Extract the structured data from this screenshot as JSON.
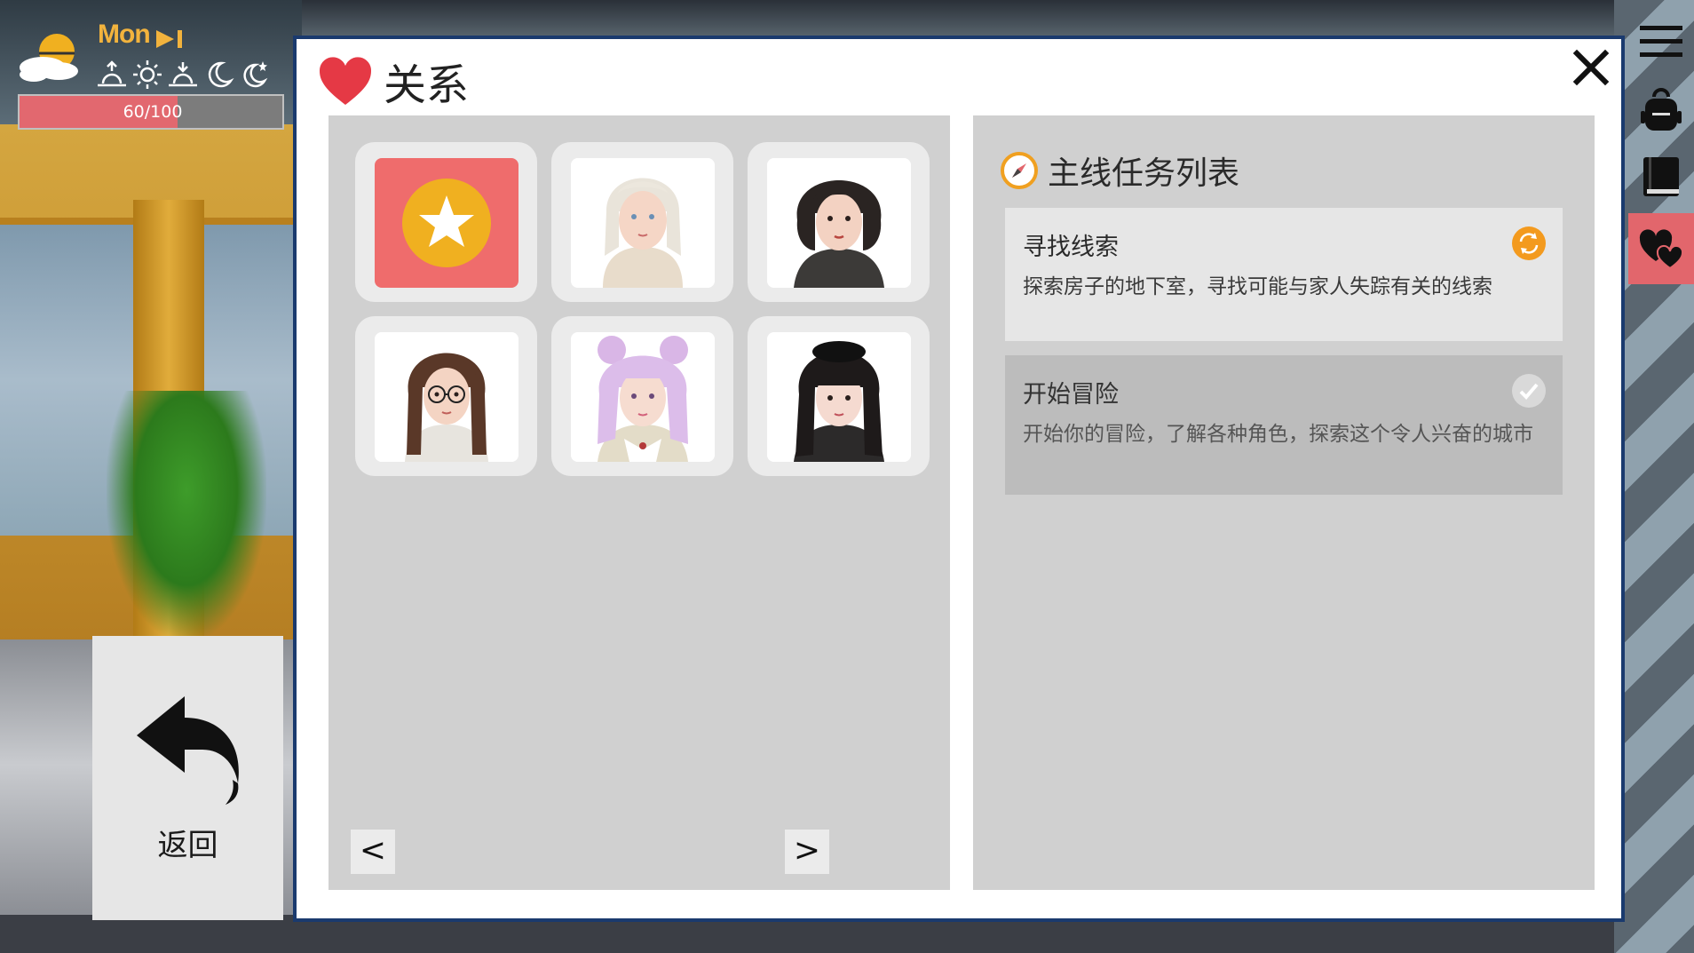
{
  "hud": {
    "day": "Mon",
    "energy_text": "60/100",
    "energy_fraction": 0.6,
    "weather_icon": "sun-behind-cloud-icon",
    "time_icons": [
      "sunrise-icon",
      "sun-icon",
      "sunset-icon",
      "moon-icon",
      "moon-star-icon"
    ]
  },
  "back_button": {
    "label": "返回",
    "icon": "undo-arrow-icon"
  },
  "sidebar": {
    "items": [
      {
        "name": "menu",
        "icon": "hamburger-menu-icon"
      },
      {
        "name": "backpack",
        "icon": "backpack-icon"
      },
      {
        "name": "journal",
        "icon": "book-icon"
      },
      {
        "name": "relationship",
        "icon": "hearts-icon",
        "active": true
      }
    ]
  },
  "dialog": {
    "title": "关系",
    "title_icon": "heart-icon",
    "close_icon": "close-icon"
  },
  "characters": [
    {
      "slot": "favorites",
      "icon": "star-icon"
    },
    {
      "slot": "character",
      "hair": "platinum blonde"
    },
    {
      "slot": "character",
      "hair": "black bob"
    },
    {
      "slot": "character",
      "hair": "brown braids, glasses"
    },
    {
      "slot": "character",
      "hair": "pink buns"
    },
    {
      "slot": "character",
      "hair": "long black"
    }
  ],
  "pagination": {
    "prev": "<",
    "next": ">"
  },
  "quests": {
    "title": "主线任务列表",
    "title_icon": "compass-icon",
    "items": [
      {
        "name": "寻找线索",
        "desc": "探索房子的地下室，寻找可能与家人失踪有关的线索",
        "status": "in-progress"
      },
      {
        "name": "开始冒险",
        "desc": "开始你的冒险，了解各种角色，探索这个令人兴奋的城市",
        "status": "completed"
      }
    ]
  },
  "colors": {
    "accent_red": "#e2666c",
    "heart_red": "#e53945",
    "star_gold": "#f0b020",
    "energy_fill": "#e2686f",
    "panel_gray": "#d0d0d0",
    "dialog_border": "#1a3a6e"
  }
}
